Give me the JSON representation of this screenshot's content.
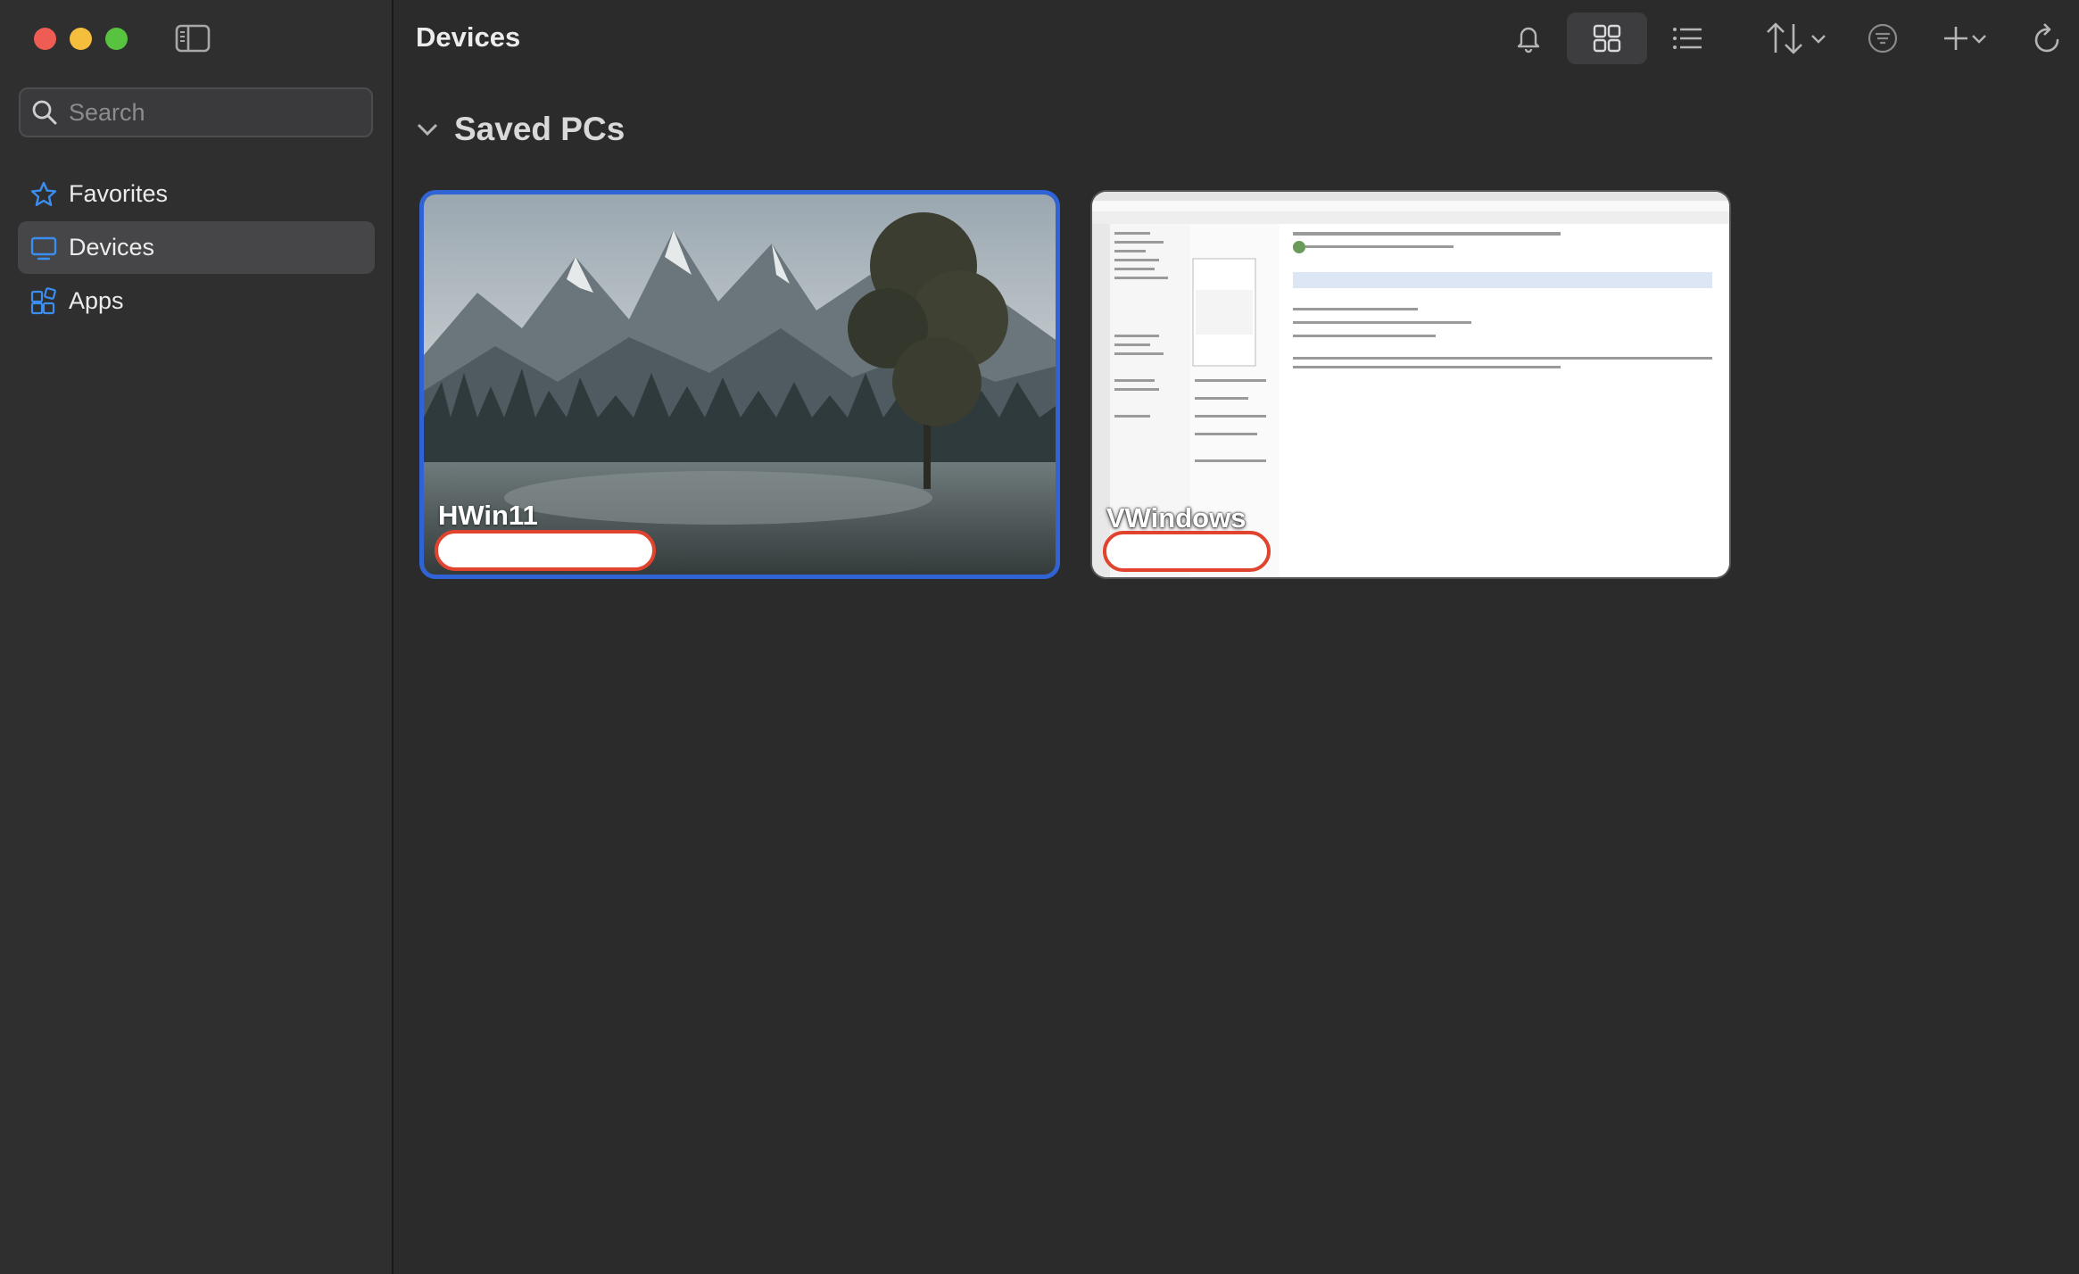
{
  "window": {
    "controls": [
      "close",
      "minimize",
      "zoom"
    ]
  },
  "sidebar": {
    "toggle_icon": "sidebar-toggle-icon",
    "search": {
      "placeholder": "Search",
      "value": ""
    },
    "items": [
      {
        "label": "Favorites",
        "icon": "star-icon",
        "active": false
      },
      {
        "label": "Devices",
        "icon": "monitor-icon",
        "active": true
      },
      {
        "label": "Apps",
        "icon": "apps-grid-icon",
        "active": false
      }
    ]
  },
  "header": {
    "title": "Devices"
  },
  "toolbar": {
    "icons": [
      "bell-icon",
      "grid-view-icon",
      "list-view-icon",
      "sort-icon",
      "filter-icon",
      "add-icon",
      "refresh-icon"
    ],
    "active_view": "grid"
  },
  "section": {
    "title": "Saved PCs",
    "expanded": true
  },
  "pcs": [
    {
      "name": "HWin11",
      "selected": true,
      "thumbnail": "mountain-forest-wallpaper"
    },
    {
      "name": "VWindows",
      "selected": false,
      "thumbnail": "outlook-email-screenshot"
    }
  ],
  "colors": {
    "accent": "#2f63d6",
    "icon_blue": "#3b8ef0",
    "pill_border": "#e0442e"
  }
}
